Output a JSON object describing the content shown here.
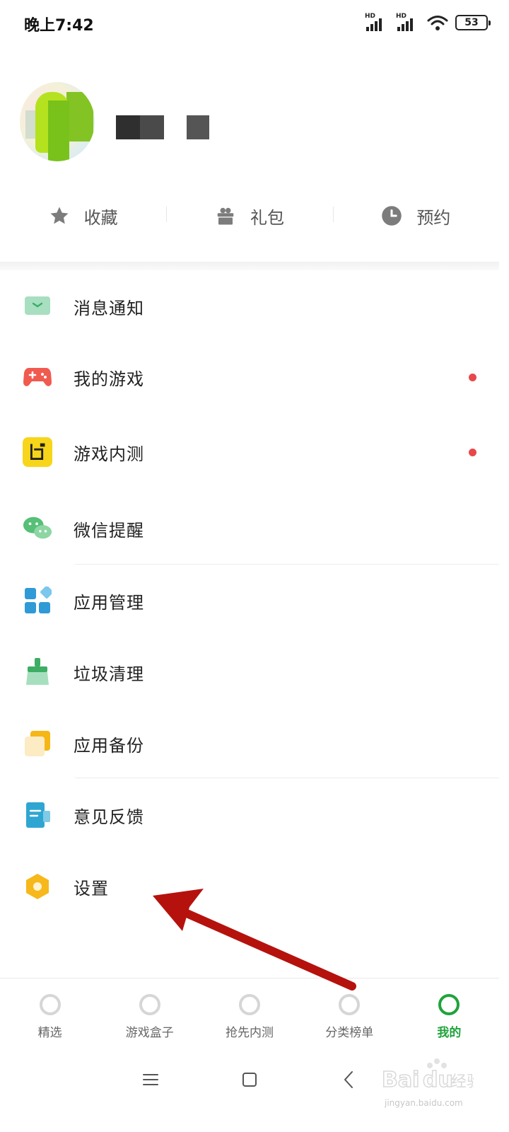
{
  "status_bar": {
    "time": "晚上7:42",
    "signal1_label": "HD",
    "signal2_label": "HD",
    "battery": "53"
  },
  "quick_actions": [
    {
      "label": "收藏",
      "icon": "star-icon"
    },
    {
      "label": "礼包",
      "icon": "gift-icon"
    },
    {
      "label": "预约",
      "icon": "clock-icon"
    }
  ],
  "menu": [
    {
      "label": "消息通知",
      "icon": "message-icon",
      "dot": false
    },
    {
      "label": "我的游戏",
      "icon": "gamepad-icon",
      "dot": true
    },
    {
      "label": "游戏内测",
      "icon": "beta-test-icon",
      "dot": true
    },
    {
      "label": "微信提醒",
      "icon": "wechat-icon",
      "dot": false
    },
    {
      "label": "应用管理",
      "icon": "app-manage-icon",
      "dot": false
    },
    {
      "label": "垃圾清理",
      "icon": "broom-icon",
      "dot": false
    },
    {
      "label": "应用备份",
      "icon": "backup-icon",
      "dot": false
    },
    {
      "label": "意见反馈",
      "icon": "feedback-icon",
      "dot": false
    },
    {
      "label": "设置",
      "icon": "settings-icon",
      "dot": false
    }
  ],
  "bottom_nav": [
    {
      "label": "精选",
      "active": false
    },
    {
      "label": "游戏盒子",
      "active": false
    },
    {
      "label": "抢先内测",
      "active": false
    },
    {
      "label": "分类榜单",
      "active": false
    },
    {
      "label": "我的",
      "active": true
    }
  ],
  "colors": {
    "accent_green": "#1fa33c",
    "red_dot": "#e8484a",
    "annotation_arrow": "#b5120e"
  },
  "watermark": {
    "logo_text": "Baidu经验",
    "url": "jingyan.baidu.com"
  }
}
